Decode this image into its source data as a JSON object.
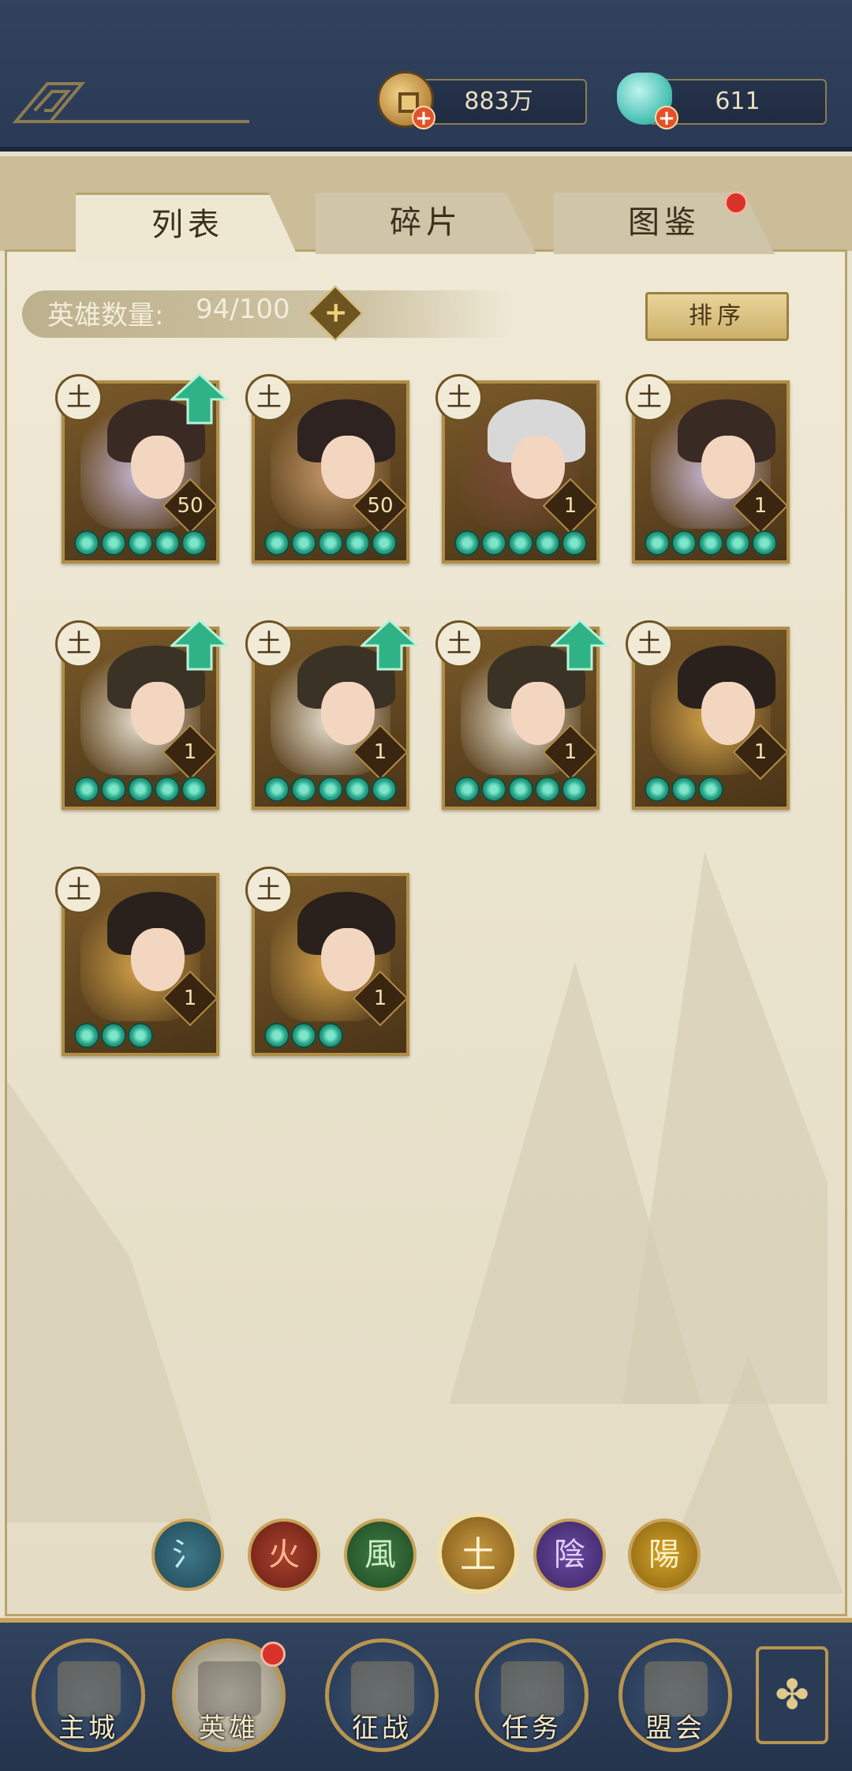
{
  "currencies": {
    "coins": "883万",
    "gems": "611"
  },
  "tabs": [
    {
      "label": "列表",
      "active": true
    },
    {
      "label": "碎片",
      "active": false
    },
    {
      "label": "图鉴",
      "active": false,
      "badge": true
    }
  ],
  "hero_count": {
    "label": "英雄数量:",
    "value": "94/100"
  },
  "sort_label": "排序",
  "hero_element_glyph": "土",
  "heroes": [
    {
      "level": "50",
      "stars": 5,
      "upgrade": true
    },
    {
      "level": "50",
      "stars": 5,
      "upgrade": false
    },
    {
      "level": "1",
      "stars": 5,
      "upgrade": false
    },
    {
      "level": "1",
      "stars": 5,
      "upgrade": false
    },
    {
      "level": "1",
      "stars": 5,
      "upgrade": true
    },
    {
      "level": "1",
      "stars": 5,
      "upgrade": true
    },
    {
      "level": "1",
      "stars": 5,
      "upgrade": true
    },
    {
      "level": "1",
      "stars": 3,
      "upgrade": false
    },
    {
      "level": "1",
      "stars": 3,
      "upgrade": false
    },
    {
      "level": "1",
      "stars": 3,
      "upgrade": false
    }
  ],
  "element_filters": [
    {
      "glyph": "氵",
      "name": "water"
    },
    {
      "glyph": "火",
      "name": "fire"
    },
    {
      "glyph": "風",
      "name": "wind"
    },
    {
      "glyph": "土",
      "name": "earth",
      "selected": true
    },
    {
      "glyph": "陰",
      "name": "yin"
    },
    {
      "glyph": "陽",
      "name": "yang"
    }
  ],
  "bottom_nav": [
    {
      "label": "主城"
    },
    {
      "label": "英雄",
      "active": true,
      "badge": true
    },
    {
      "label": "征战"
    },
    {
      "label": "任务"
    },
    {
      "label": "盟会"
    }
  ],
  "colors": {
    "accent_gold": "#b08d46",
    "nav_bg": "#31435f",
    "badge_red": "#d8332a",
    "star_teal": "#27a386"
  }
}
